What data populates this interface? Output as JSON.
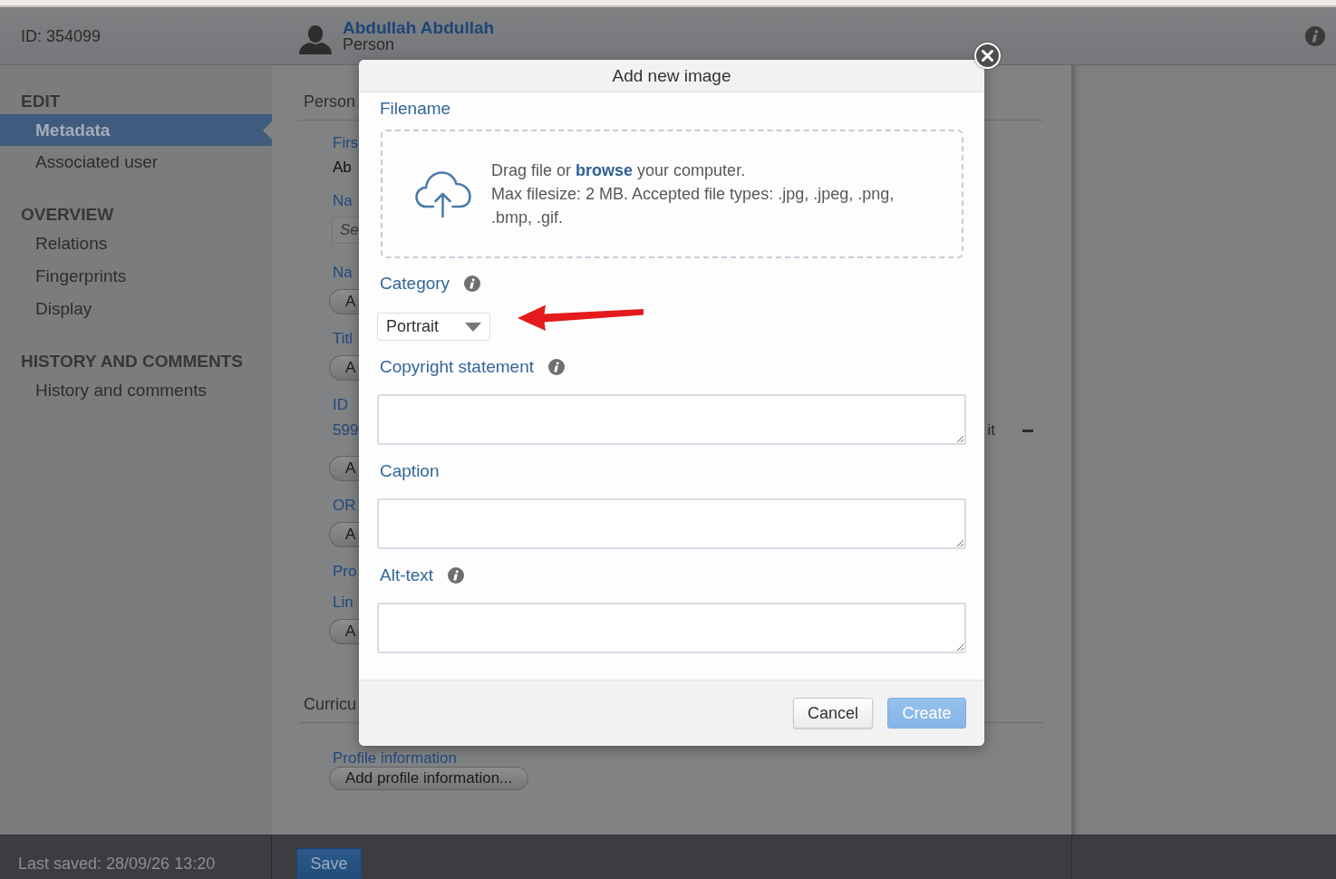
{
  "top_bar": {
    "record_id": "ID: 354099",
    "person_name": "Abdullah Abdullah",
    "person_type": "Person"
  },
  "sidebar": {
    "sections": [
      {
        "title": "EDIT",
        "items": [
          {
            "label": "Metadata",
            "selected": true
          },
          {
            "label": "Associated user",
            "selected": false
          }
        ]
      },
      {
        "title": "OVERVIEW",
        "items": [
          {
            "label": "Relations",
            "selected": false
          },
          {
            "label": "Fingerprints",
            "selected": false
          },
          {
            "label": "Display",
            "selected": false
          }
        ]
      },
      {
        "title": "HISTORY AND COMMENTS",
        "items": [
          {
            "label": "History and comments",
            "selected": false
          }
        ]
      }
    ]
  },
  "record_form": {
    "sections": [
      {
        "title": "Person",
        "items": [
          {
            "kind": "label",
            "text": "Firs"
          },
          {
            "kind": "value",
            "text": "Ab"
          },
          {
            "kind": "label",
            "text": "Na"
          },
          {
            "kind": "input",
            "placeholder": "Se"
          },
          {
            "kind": "label",
            "text": "Na"
          },
          {
            "kind": "button",
            "text": "A"
          },
          {
            "kind": "label",
            "text": "Titl"
          },
          {
            "kind": "button",
            "text": "A"
          },
          {
            "kind": "label",
            "text": "ID"
          },
          {
            "kind": "link",
            "text": "599",
            "trailing_text": "it"
          },
          {
            "kind": "button",
            "text": "A"
          },
          {
            "kind": "label",
            "text": "OR"
          },
          {
            "kind": "button",
            "text": "A"
          },
          {
            "kind": "label",
            "text": "Pro"
          },
          {
            "kind": "label",
            "text": "Lin"
          },
          {
            "kind": "button",
            "text": "A"
          }
        ]
      },
      {
        "title": "Curricu",
        "items": [
          {
            "kind": "label",
            "text": "Profile information"
          },
          {
            "kind": "button",
            "text": "Add profile information..."
          }
        ]
      }
    ]
  },
  "status_bar": {
    "last_saved": "Last saved: 28/09/26 13:20",
    "save_button": "Save"
  },
  "dialog": {
    "title": "Add new image",
    "fields": [
      {
        "kind": "upload",
        "label": "Filename",
        "instruction": "Drag file or **browse** your computer.",
        "note": "Max filesize: 2 MB. Accepted file types: .jpg, .jpeg, .png, .bmp, .gif."
      },
      {
        "kind": "select",
        "label": "Category",
        "info": true,
        "value": "Portrait"
      },
      {
        "kind": "textarea",
        "label": "Copyright statement",
        "info": true
      },
      {
        "kind": "textarea",
        "label": "Caption",
        "info": false
      },
      {
        "kind": "textarea",
        "label": "Alt-text",
        "info": true
      }
    ],
    "buttons": [
      {
        "label": "Cancel",
        "kind": "secondary",
        "disabled": false
      },
      {
        "label": "Create",
        "kind": "primary",
        "disabled": true
      }
    ]
  }
}
